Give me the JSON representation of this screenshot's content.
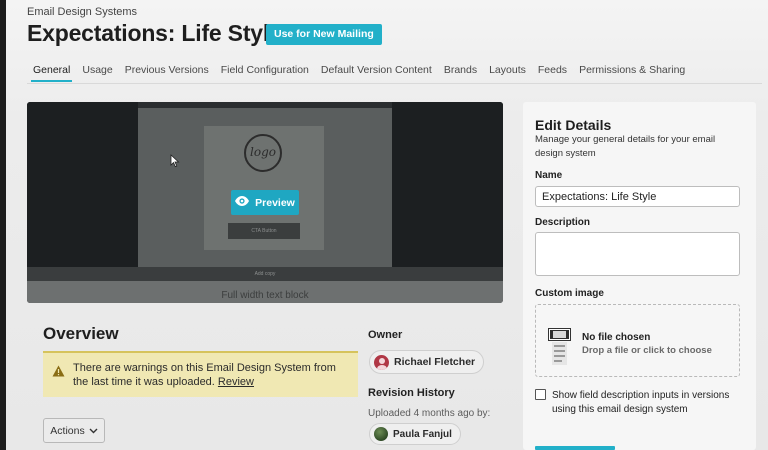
{
  "breadcrumb": "Email Design Systems",
  "header": {
    "title": "Expectations: Life Style",
    "use_button": "Use for New Mailing"
  },
  "tabs": [
    {
      "label": "General",
      "active": true
    },
    {
      "label": "Usage"
    },
    {
      "label": "Previous Versions"
    },
    {
      "label": "Field Configuration"
    },
    {
      "label": "Default Version Content"
    },
    {
      "label": "Brands"
    },
    {
      "label": "Layouts"
    },
    {
      "label": "Feeds"
    },
    {
      "label": "Permissions & Sharing"
    }
  ],
  "preview": {
    "logo_text": "logo",
    "button_label": "Preview",
    "cta_text": "CTA Button",
    "strip_text": "Add copy",
    "bottom_text": "Full width text block"
  },
  "overview": {
    "title": "Overview",
    "warning_text": "There are warnings on this Email Design System from the last time it was uploaded.",
    "warning_link": "Review",
    "actions_button": "Actions"
  },
  "owner": {
    "label": "Owner",
    "name": "Richael Fletcher"
  },
  "revision": {
    "label": "Revision History",
    "text": "Uploaded 4 months ago by:",
    "name": "Paula Fanjul"
  },
  "edit_details": {
    "title": "Edit Details",
    "description": "Manage your general details for your email design system",
    "name_label": "Name",
    "name_value": "Expectations: Life Style",
    "description_label": "Description",
    "description_value": "",
    "custom_image_label": "Custom image",
    "no_file": "No file chosen",
    "drop_hint": "Drop a file or click to choose",
    "checkbox_label": "Show field description inputs in versions using this email design system"
  },
  "colors": {
    "accent": "#22b0c9",
    "warning_bg": "#f0e8b3"
  }
}
